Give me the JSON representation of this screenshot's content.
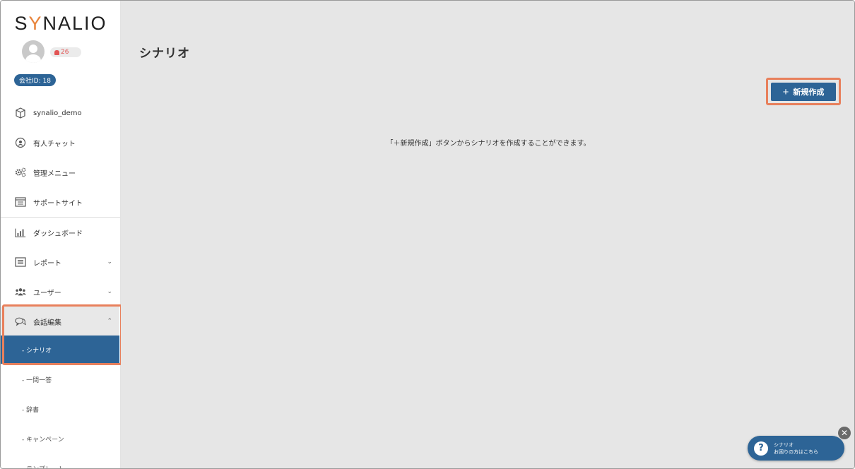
{
  "app": {
    "logo_text_left": "S",
    "logo_text_accent": "Y",
    "logo_text_right": "NALIO",
    "notification_count": "26",
    "company_id": "会社ID: 18"
  },
  "sidebar": {
    "top_items": [
      {
        "label": "synalio_demo",
        "icon": "cube-icon"
      },
      {
        "label": "有人チャット",
        "icon": "headset-icon"
      },
      {
        "label": "管理メニュー",
        "icon": "gears-icon"
      },
      {
        "label": "サポートサイト",
        "icon": "browser-icon"
      }
    ],
    "main_items": [
      {
        "label": "ダッシュボード",
        "icon": "bar-chart-icon"
      },
      {
        "label": "レポート",
        "icon": "list-icon",
        "expandable": true
      },
      {
        "label": "ユーザー",
        "icon": "users-icon",
        "expandable": true
      },
      {
        "label": "会話編集",
        "icon": "chat-icon",
        "expanded": true
      }
    ],
    "sub_items": [
      {
        "label": "- シナリオ",
        "active": true
      },
      {
        "label": "- 一問一答"
      },
      {
        "label": "- 辞書"
      },
      {
        "label": "- キャンペーン"
      },
      {
        "label": "- テンプレート"
      }
    ]
  },
  "main": {
    "title": "シナリオ",
    "new_button_label": "新規作成",
    "empty_message": "「＋新規作成」ボタンからシナリオを作成することができます。"
  },
  "help_widget": {
    "line1": "シナリオ",
    "line2": "お困りの方はこちら"
  },
  "colors": {
    "accent_blue": "#2d6496",
    "highlight_orange": "#e8805c",
    "main_bg": "#e6e6e6"
  }
}
